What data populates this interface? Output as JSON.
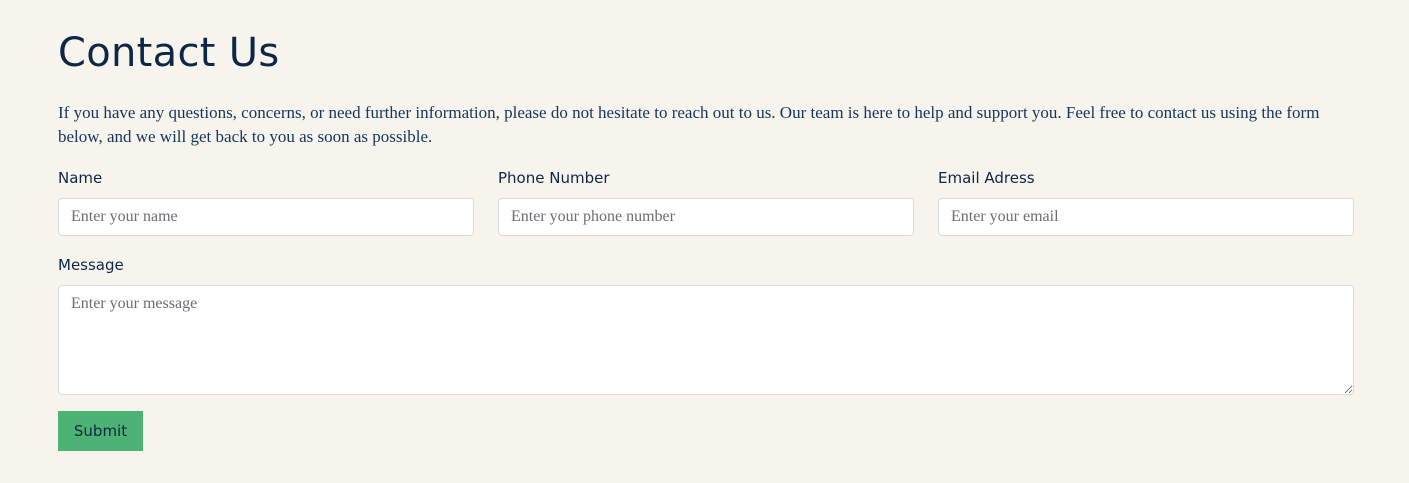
{
  "page": {
    "title": "Contact Us",
    "intro": "If you have any questions, concerns, or need further information, please do not hesitate to reach out to us. Our team is here to help and support you. Feel free to contact us using the form below, and we will get back to you as soon as possible."
  },
  "form": {
    "name": {
      "label": "Name",
      "placeholder": "Enter your name",
      "value": ""
    },
    "phone": {
      "label": "Phone Number",
      "placeholder": "Enter your phone number",
      "value": ""
    },
    "email": {
      "label": "Email Adress",
      "placeholder": "Enter your email",
      "value": ""
    },
    "message": {
      "label": "Message",
      "placeholder": "Enter your message",
      "value": ""
    },
    "submit_label": "Submit"
  },
  "colors": {
    "background": "#f7f4ee",
    "heading": "#0e2747",
    "body_text": "#14365c",
    "button": "#4db374"
  }
}
